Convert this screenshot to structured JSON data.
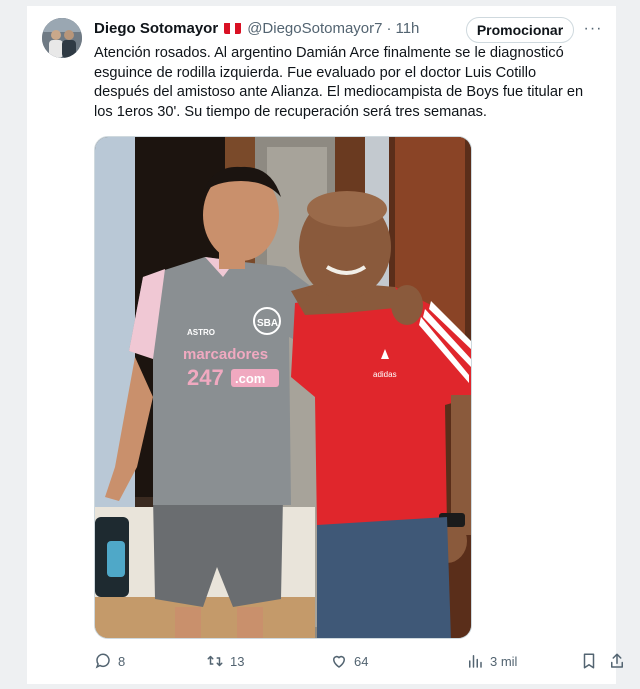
{
  "tweet": {
    "author_name": "Diego Sotomayor",
    "handle": "@DiegoSotomayor7",
    "separator": "·",
    "time": "11h",
    "promote_label": "Promocionar",
    "more_label": "···",
    "text": "Atención rosados. Al argentino Damián Arce finalmente se le diagnosticó esguince de rodilla izquierda. Fue evaluado por el doctor Luis Cotillo después del amistoso ante Alianza. El mediocampista de Boys fue titular en los 1eros 30'. Su tiempo de recuperación será tres semanas.",
    "image": {
      "jersey_brand": "marcadores",
      "jersey_sponsor_number": "247",
      "jersey_sponsor_domain": ".com",
      "jersey_club": "SBA",
      "jersey_maker": "ASTRO",
      "tshirt_brand": "adidas"
    },
    "actions": {
      "replies": "8",
      "reposts": "13",
      "likes": "64",
      "views": "3 mil"
    }
  },
  "colors": {
    "flag_red": "#d91023",
    "jersey_grey": "#8a8f92",
    "jersey_pink": "#f0a9c0",
    "shirt_red": "#e0262c",
    "text_secondary": "#536471"
  },
  "icons": [
    "reply-icon",
    "repost-icon",
    "like-icon",
    "views-icon",
    "bookmark-icon",
    "share-icon",
    "more-icon",
    "flag-icon"
  ]
}
